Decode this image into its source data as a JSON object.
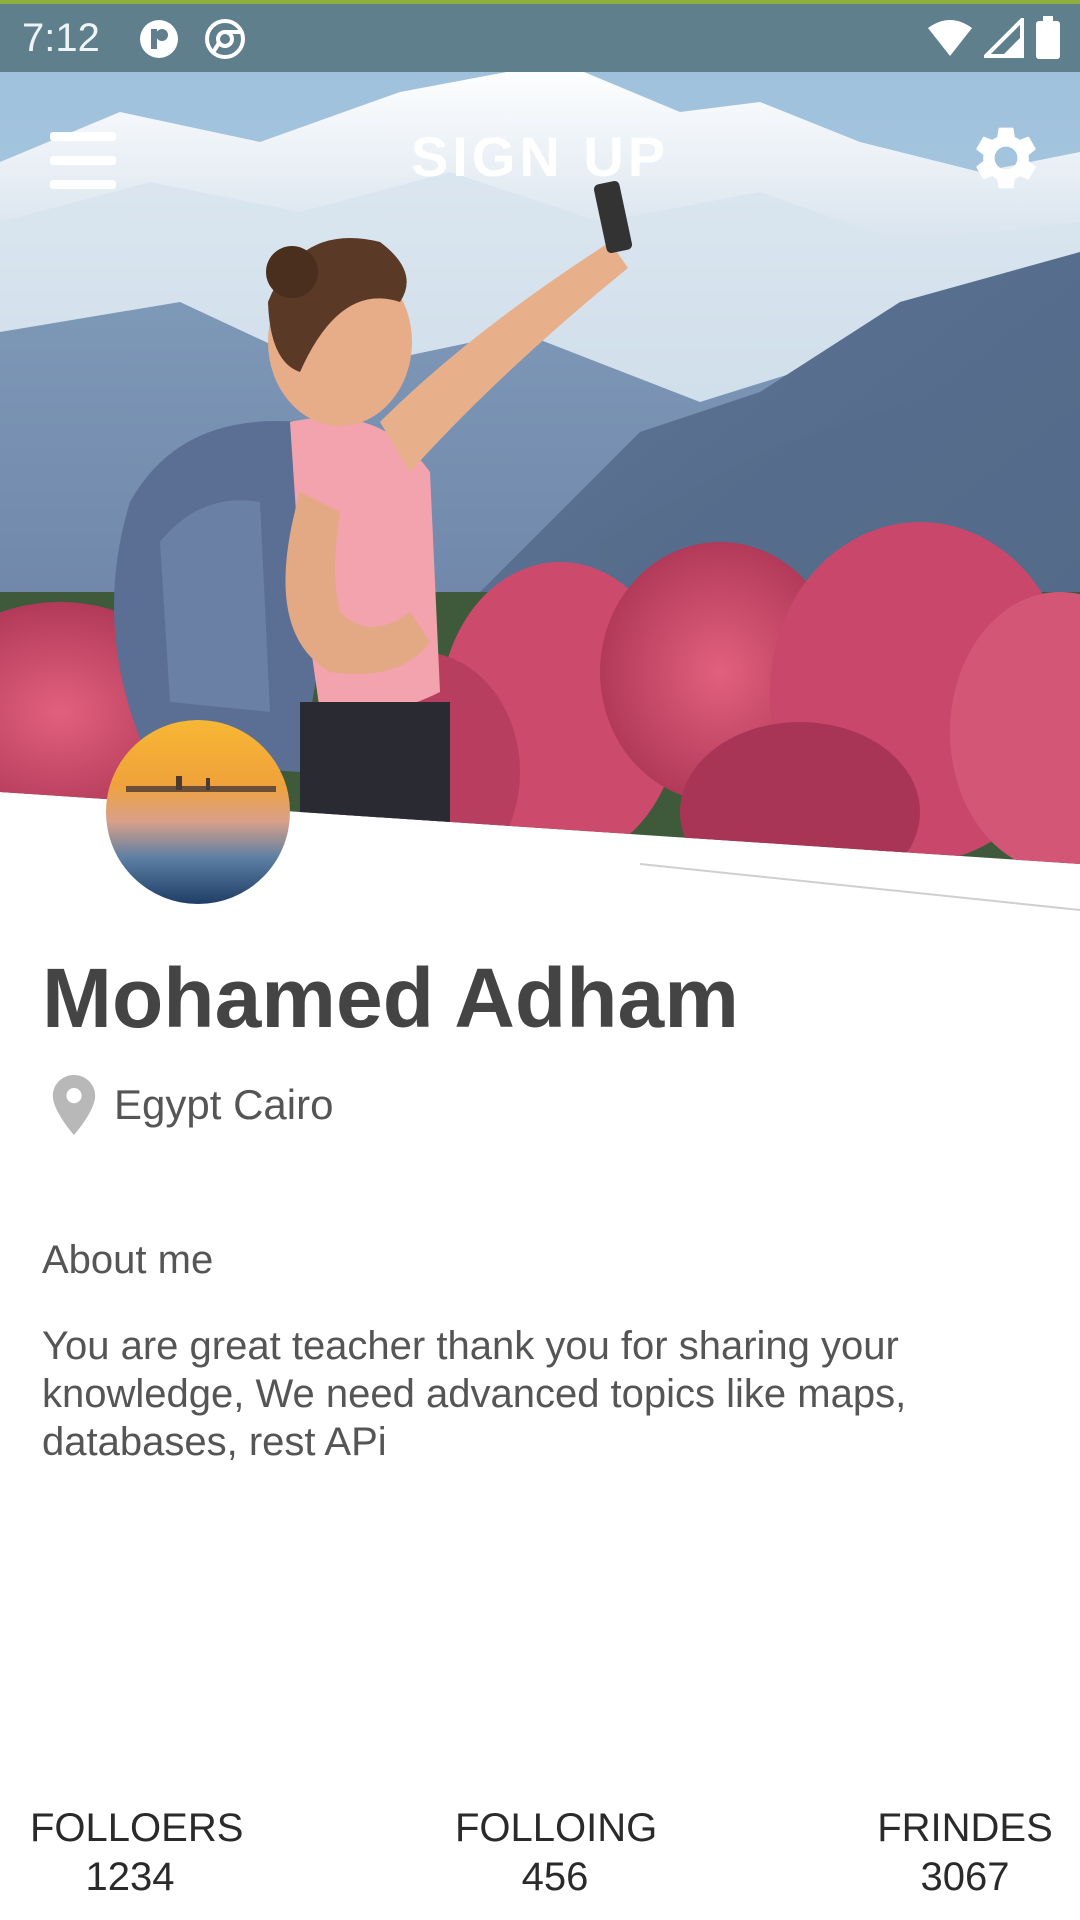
{
  "status_bar": {
    "time": "7:12",
    "icons": [
      "notification-app-icon",
      "chrome-icon",
      "wifi-icon",
      "signal-icon",
      "battery-icon"
    ]
  },
  "header": {
    "title": "SIGN UP",
    "menu_icon": "hamburger-menu-icon",
    "settings_icon": "gear-icon"
  },
  "profile": {
    "name": "Mohamed Adham",
    "location": "Egypt Cairo",
    "about_label": "About me",
    "about_text": "You are great teacher thank you for sharing your knowledge, We need advanced topics like maps, databases, rest APi"
  },
  "stats": [
    {
      "label": "FOLLOERS",
      "value": "1234"
    },
    {
      "label": "FOLLOING",
      "value": "456"
    },
    {
      "label": "FRINDES",
      "value": "3067"
    }
  ],
  "colors": {
    "status_bar": "#5f7f8c",
    "text_dark": "#444444",
    "text_body": "#555555"
  }
}
